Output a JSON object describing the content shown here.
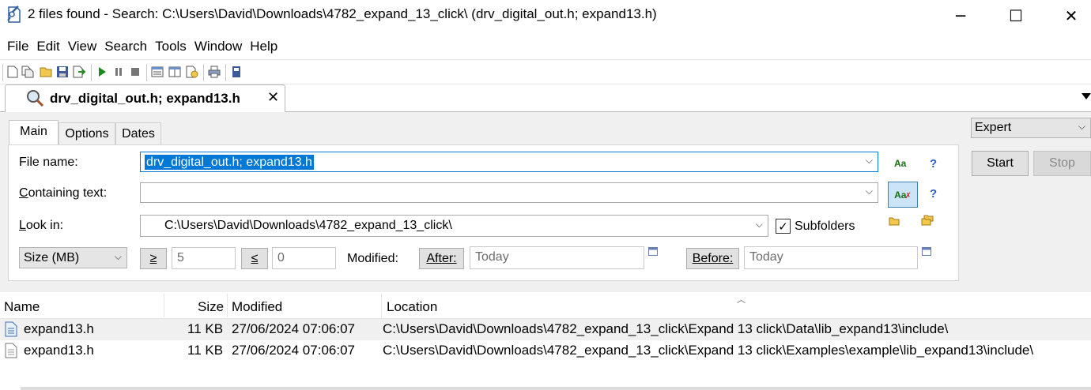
{
  "window": {
    "title": "2 files found - Search: C:\\Users\\David\\Downloads\\4782_expand_13_click\\ (drv_digital_out.h; expand13.h)",
    "minimize": "─",
    "maximize": "☐",
    "close": "✕"
  },
  "menu": [
    "File",
    "Edit",
    "View",
    "Search",
    "Tools",
    "Window",
    "Help"
  ],
  "tab": {
    "label": "drv_digital_out.h; expand13.h",
    "close": "✕"
  },
  "subtabs": [
    "Main",
    "Options",
    "Dates"
  ],
  "mode_select": {
    "value": "Expert"
  },
  "buttons": {
    "start": "Start",
    "stop": "Stop"
  },
  "form": {
    "file_name_label": "File name:",
    "file_name_value": "drv_digital_out.h; expand13.h",
    "containing_text_label": "Containing text:",
    "containing_text_value": "",
    "look_in_label": "Look in:",
    "look_in_value": "C:\\Users\\David\\Downloads\\4782_expand_13_click\\",
    "subfolders_label": "Subfolders",
    "subfolders_checked": true,
    "size_unit": "Size (MB)",
    "gte_label": "≥",
    "gte_value": "5",
    "lte_label": "≤",
    "lte_value": "0",
    "modified_label": "Modified:",
    "after_label": "After:",
    "after_value": "Today",
    "before_label": "Before:",
    "before_value": "Today",
    "case_icon_text": "Aa",
    "help": "?"
  },
  "results": {
    "columns": [
      "Name",
      "Size",
      "Modified",
      "Location"
    ],
    "rows": [
      {
        "name": "expand13.h",
        "size": "11 KB",
        "modified": "27/06/2024 07:06:07",
        "location": "C:\\Users\\David\\Downloads\\4782_expand_13_click\\Expand 13 click\\Data\\lib_expand13\\include\\"
      },
      {
        "name": "expand13.h",
        "size": "11 KB",
        "modified": "27/06/2024 07:06:07",
        "location": "C:\\Users\\David\\Downloads\\4782_expand_13_click\\Expand 13 click\\Examples\\example\\lib_expand13\\include\\"
      }
    ]
  },
  "colors": {
    "selection": "#0078d7",
    "panel_bg": "#f0f0f0",
    "help_blue": "#2a62c9",
    "row_alt": "#f0f0f0"
  }
}
